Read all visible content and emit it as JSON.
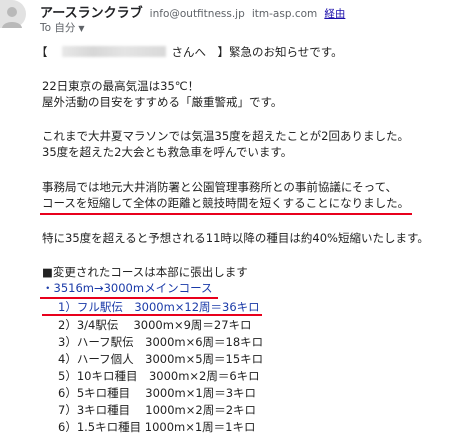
{
  "sender": {
    "name": "アースランクラブ",
    "email": "info@outfitness.jp",
    "via_domain": "itm-asp.com",
    "via_label": "経由"
  },
  "recipient": {
    "to_label": "To 自分",
    "chevron_icon": "chevron-down-icon"
  },
  "body": {
    "greeting_prefix": "【",
    "greeting_suffix": "さんへ　】緊急のお知らせです。",
    "p1_l1": "22日東京の最高気温は35℃！",
    "p1_l2": "屋外活動の目安をすすめる「厳重警戒」です。",
    "p2_l1": "これまで大井夏マラソンでは気温35度を超えたことが2回ありました。",
    "p2_l2": "35度を超えた2大会とも救急車を呼んでいます。",
    "p3_l1": "事務局では地元大井消防署と公園管理事務所との事前協議にそって、",
    "p3_l2": "コースを短縮して全体の距離と競技時間を短くすることになりました。",
    "p4_l1": "特に35度を超えると予想される11時以降の種目は約40%短縮いたします。",
    "changes_heading": "■変更されたコースは本部に張出します",
    "course_line": "・3516m→3000mメインコース",
    "items": [
      "1）フル駅伝　3000m×12周＝36キロ",
      "2）3/4駅伝　 3000m×9周＝27キロ",
      "3）ハーフ駅伝　3000m×6周＝18キロ",
      "4）ハーフ個人　3000m×5周＝15キロ",
      "5）10キロ種目　3000m×2周＝6キロ",
      "6）5キロ種目　 3000m×1周＝3キロ",
      "7）3キロ種目　 1000m×2周＝2キロ",
      "6）1.5キロ種目 1000m×1周＝1キロ"
    ]
  },
  "colors": {
    "highlight_underline": "#e8001c",
    "course_text": "#1a3aa8",
    "link": "#1a0dab"
  }
}
